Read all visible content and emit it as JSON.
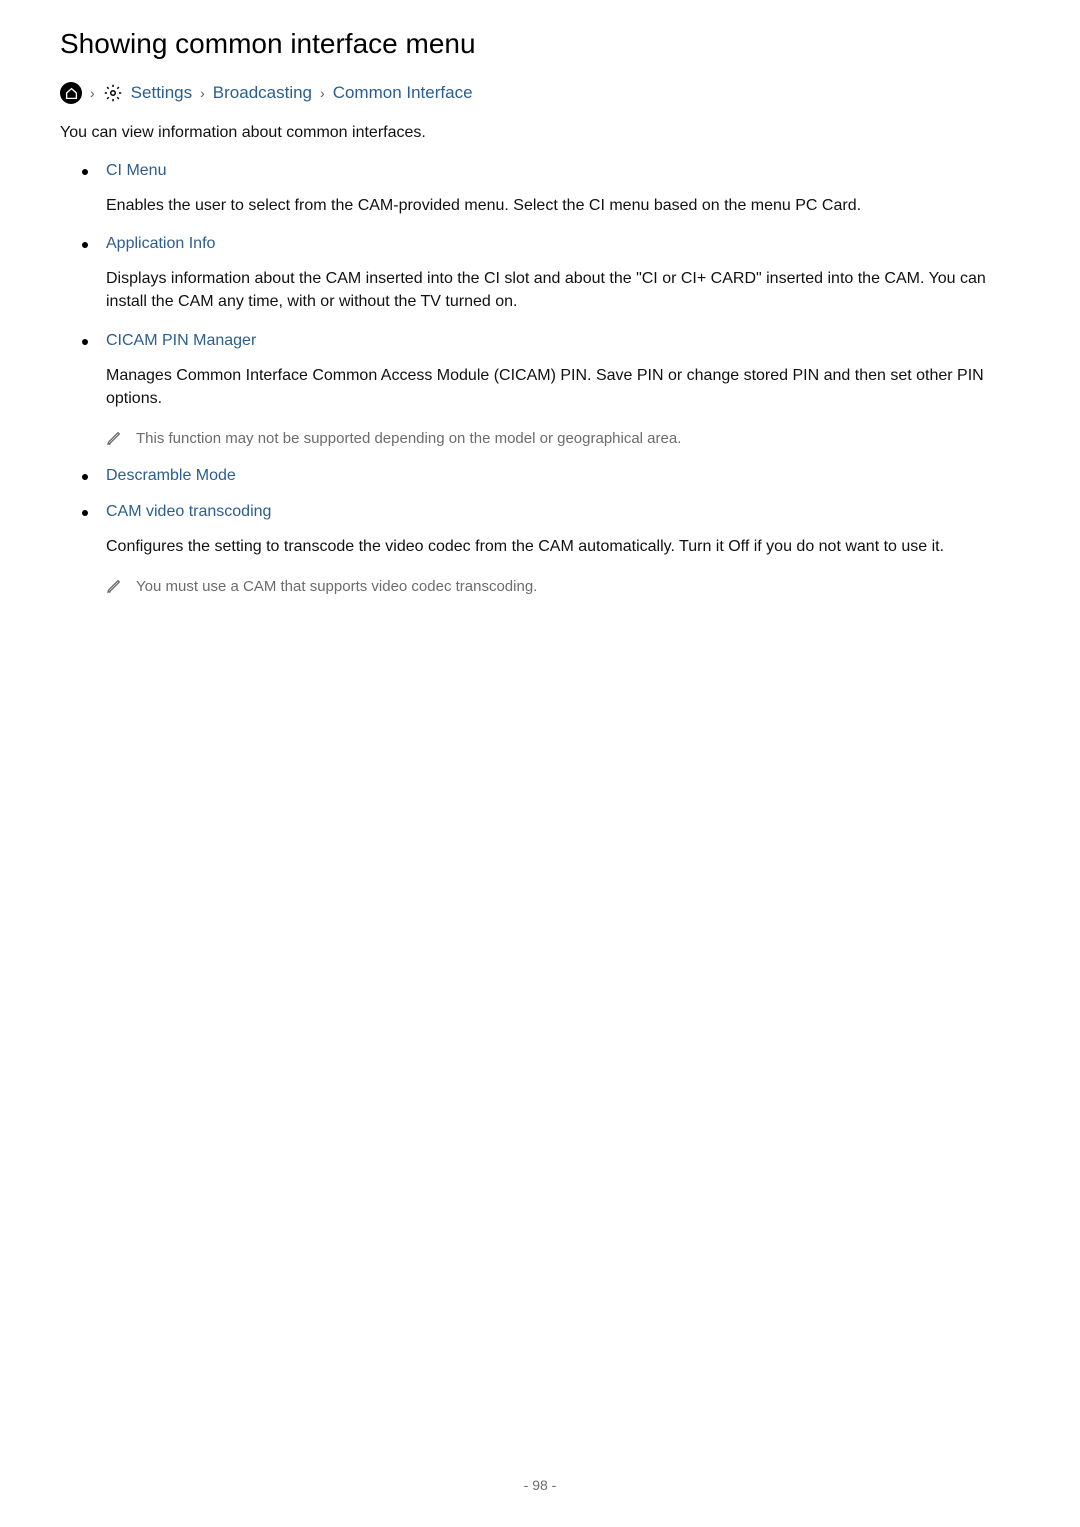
{
  "title": "Showing common interface menu",
  "breadcrumb": {
    "settings": "Settings",
    "broadcasting": "Broadcasting",
    "common_interface": "Common Interface"
  },
  "intro": "You can view information about common interfaces.",
  "items": [
    {
      "title": "CI Menu",
      "desc": "Enables the user to select from the CAM-provided menu. Select the CI menu based on the menu PC Card.",
      "note": null
    },
    {
      "title": "Application Info",
      "desc": "Displays information about the CAM inserted into the CI slot and about the \"CI or CI+ CARD\" inserted into the CAM. You can install the CAM any time, with or without the TV turned on.",
      "note": null
    },
    {
      "title": "CICAM PIN Manager",
      "desc": "Manages Common Interface Common Access Module (CICAM) PIN. Save PIN or change stored PIN and then set other PIN options.",
      "note": "This function may not be supported depending on the model or geographical area."
    },
    {
      "title": "Descramble Mode",
      "desc": null,
      "note": null
    },
    {
      "title": "CAM video transcoding",
      "desc": "Configures the setting to transcode the video codec from the CAM automatically. Turn it Off if you do not want to use it.",
      "note": "You must use a CAM that supports video codec transcoding."
    }
  ],
  "page_number": "- 98 -"
}
